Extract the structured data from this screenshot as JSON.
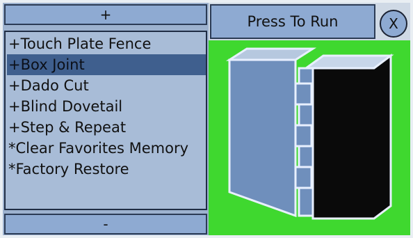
{
  "left_panel": {
    "scroll_up_label": "+",
    "scroll_down_label": "-",
    "items": [
      {
        "label": "+Touch Plate Fence",
        "selected": false
      },
      {
        "label": "+Box Joint",
        "selected": true
      },
      {
        "label": "+Dado Cut",
        "selected": false
      },
      {
        "label": "+Blind Dovetail",
        "selected": false
      },
      {
        "label": "+Step & Repeat",
        "selected": false
      },
      {
        "label": "*Clear Favorites Memory",
        "selected": false
      },
      {
        "label": "*Factory Restore",
        "selected": false
      }
    ]
  },
  "toolbar": {
    "run_label": "Press To Run",
    "close_label": "X"
  },
  "preview": {
    "icon": "box-joint-diagram",
    "background_color": "#3fd82f"
  }
}
